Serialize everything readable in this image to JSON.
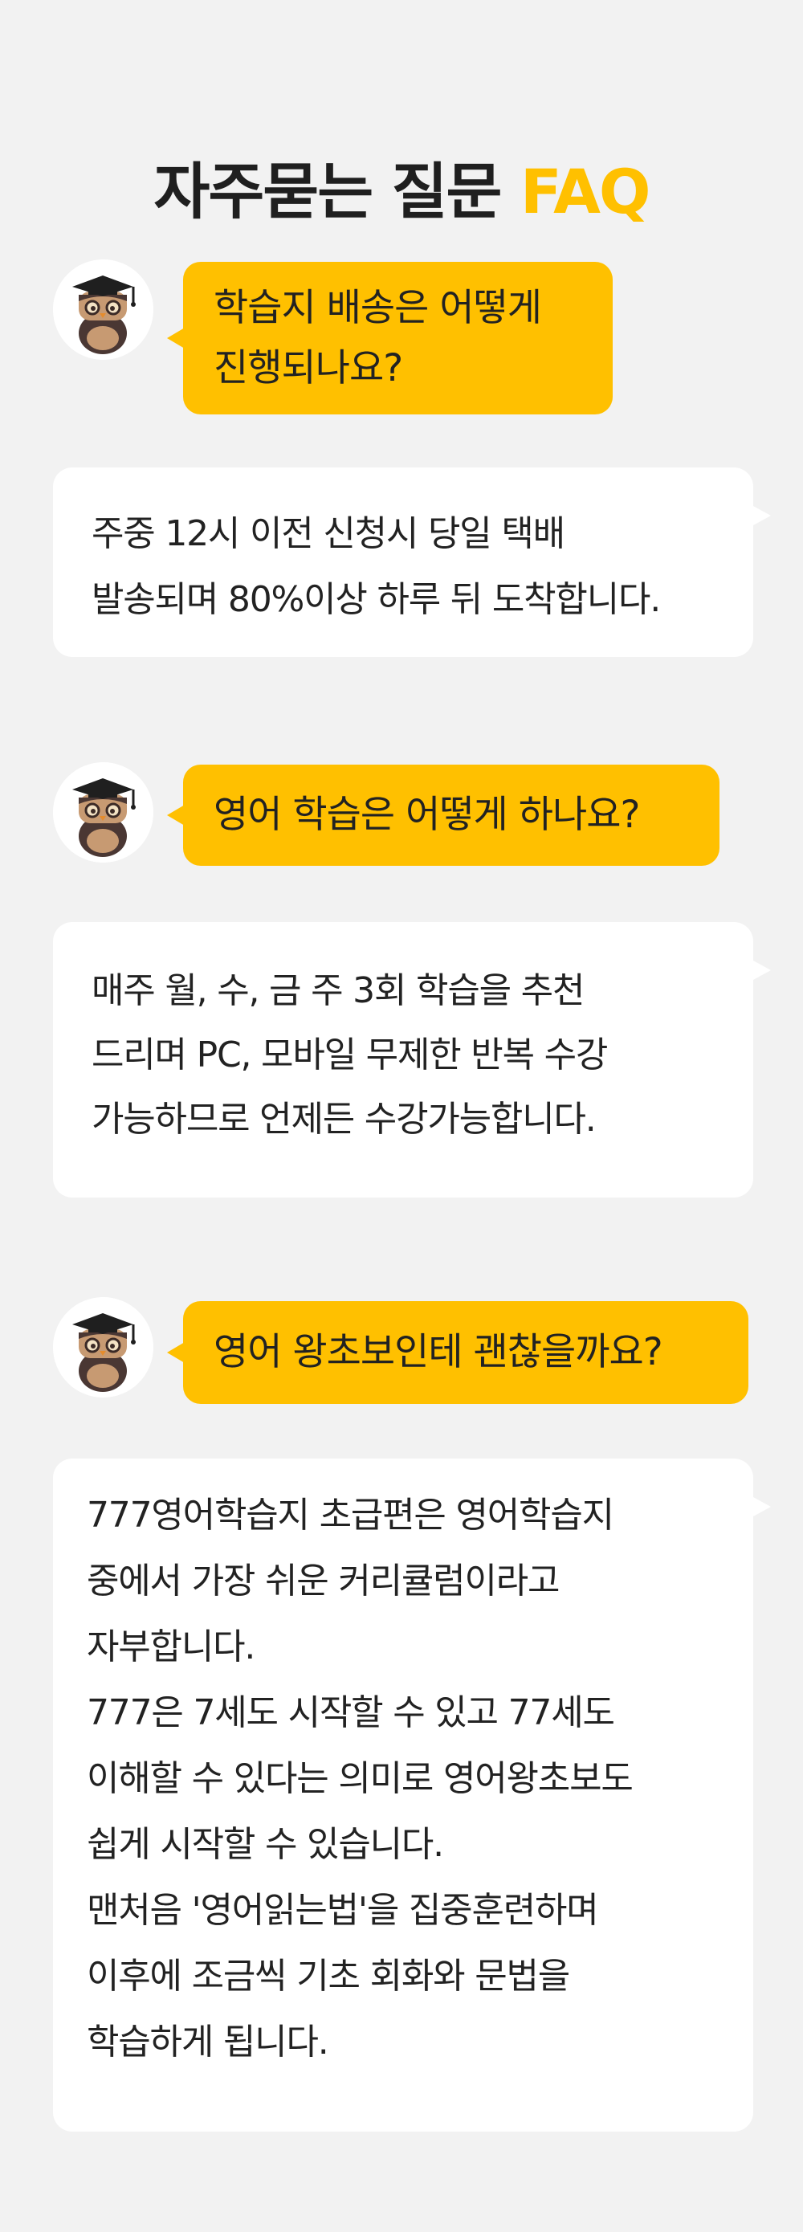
{
  "title": {
    "main": "자주묻는 질문 ",
    "accent": "FAQ"
  },
  "colors": {
    "background": "#f2f2f2",
    "accent": "#ffc000",
    "answer_bubble": "#ffffff",
    "text": "#1f1f1f"
  },
  "avatar_icon": "owl-graduate-icon",
  "faqs": [
    {
      "question": "학습지 배송은 어떻게\n진행되나요?",
      "answer": "주중 12시 이전 신청시 당일 택배\n발송되며 80%이상 하루 뒤 도착합니다."
    },
    {
      "question": "영어 학습은 어떻게 하나요?",
      "answer": "매주 월, 수, 금 주 3회 학습을 추천\n드리며 PC, 모바일 무제한 반복 수강\n가능하므로 언제든 수강가능합니다."
    },
    {
      "question": "영어 왕초보인테 괜찮을까요?",
      "answer": "777영어학습지 초급편은 영어학습지\n중에서 가장 쉬운 커리큘럼이라고\n자부합니다.\n777은 7세도 시작할 수 있고 77세도\n이해할 수 있다는 의미로 영어왕초보도\n쉽게 시작할 수 있습니다.\n맨처음 '영어읽는법'을 집중훈련하며\n이후에 조금씩 기초 회화와 문법을\n학습하게 됩니다."
    }
  ]
}
